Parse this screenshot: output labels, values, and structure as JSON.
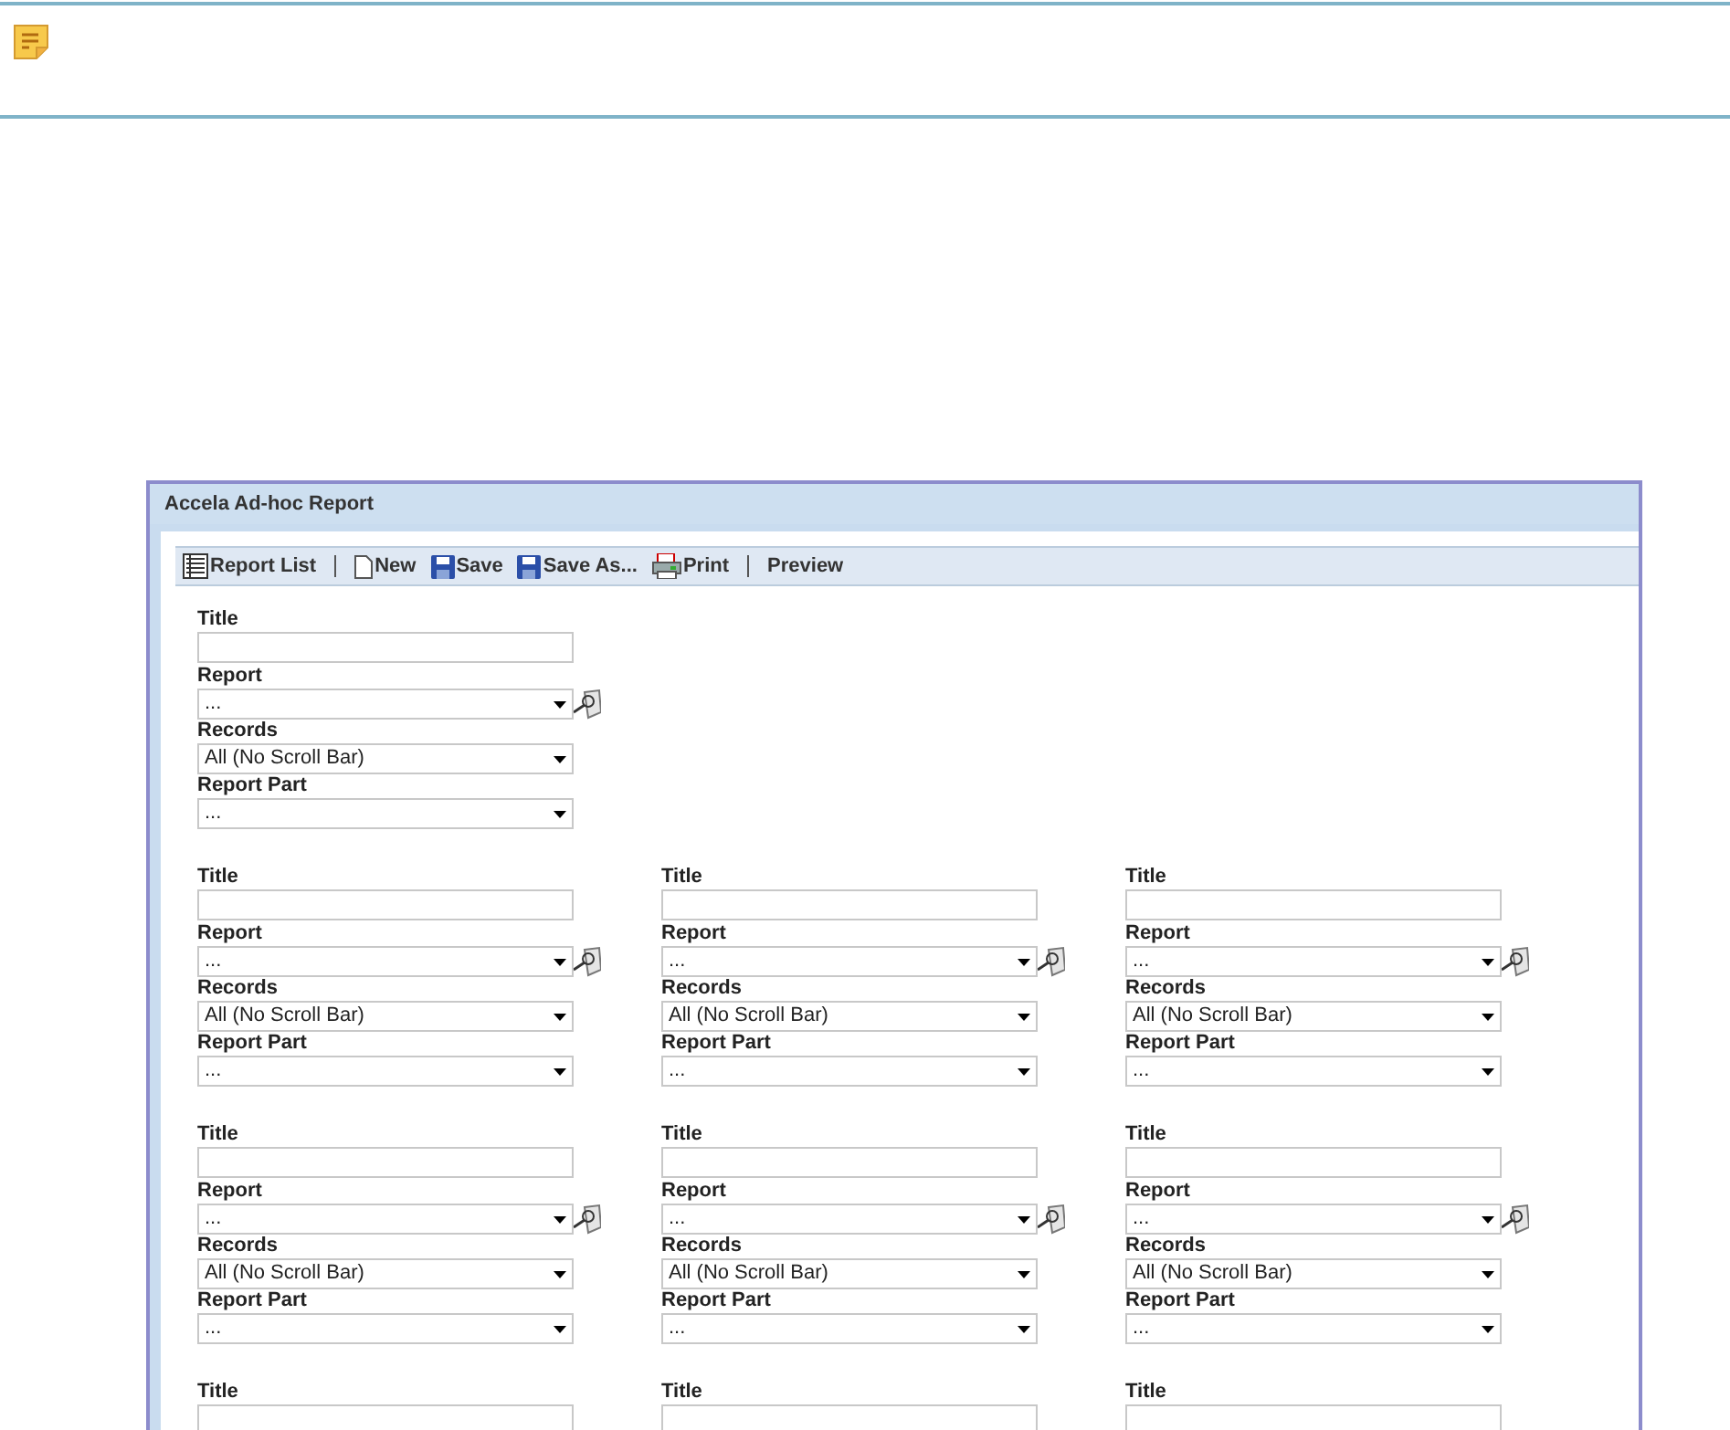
{
  "report": {
    "title": "Accela Ad-hoc Report",
    "toolbar": [
      {
        "kind": "list",
        "label": "Report List"
      },
      {
        "kind": "separator"
      },
      {
        "kind": "page",
        "label": "New"
      },
      {
        "kind": "disk",
        "label": "Save"
      },
      {
        "kind": "disk",
        "label": "Save As..."
      },
      {
        "kind": "printer",
        "label": "Print"
      },
      {
        "kind": "separator"
      },
      {
        "kind": "plain",
        "label": "Preview"
      }
    ],
    "rows": [
      [
        {
          "kind": "full",
          "title_label": "Title",
          "report_label": "Report",
          "report_value": "...",
          "records_label": "Records",
          "records_value": "All (No Scroll Bar)",
          "part_label": "Report Part",
          "part_value": "..."
        }
      ],
      [
        {
          "kind": "full",
          "title_label": "Title",
          "report_label": "Report",
          "report_value": "...",
          "records_label": "Records",
          "records_value": "All (No Scroll Bar)",
          "part_label": "Report Part",
          "part_value": "..."
        },
        {
          "kind": "full",
          "title_label": "Title",
          "report_label": "Report",
          "report_value": "...",
          "records_label": "Records",
          "records_value": "All (No Scroll Bar)",
          "part_label": "Report Part",
          "part_value": "..."
        },
        {
          "kind": "full",
          "title_label": "Title",
          "report_label": "Report",
          "report_value": "...",
          "records_label": "Records",
          "records_value": "All (No Scroll Bar)",
          "part_label": "Report Part",
          "part_value": "..."
        }
      ],
      [
        {
          "kind": "full",
          "title_label": "Title",
          "report_label": "Report",
          "report_value": "...",
          "records_label": "Records",
          "records_value": "All (No Scroll Bar)",
          "part_label": "Report Part",
          "part_value": "..."
        },
        {
          "kind": "full",
          "title_label": "Title",
          "report_label": "Report",
          "report_value": "...",
          "records_label": "Records",
          "records_value": "All (No Scroll Bar)",
          "part_label": "Report Part",
          "part_value": "..."
        },
        {
          "kind": "full",
          "title_label": "Title",
          "report_label": "Report",
          "report_value": "...",
          "records_label": "Records",
          "records_value": "All (No Scroll Bar)",
          "part_label": "Report Part",
          "part_value": "..."
        }
      ],
      [
        {
          "kind": "title_only",
          "title_label": "Title"
        },
        {
          "kind": "title_only",
          "title_label": "Title"
        },
        {
          "kind": "title_only",
          "title_label": "Title"
        }
      ]
    ]
  }
}
